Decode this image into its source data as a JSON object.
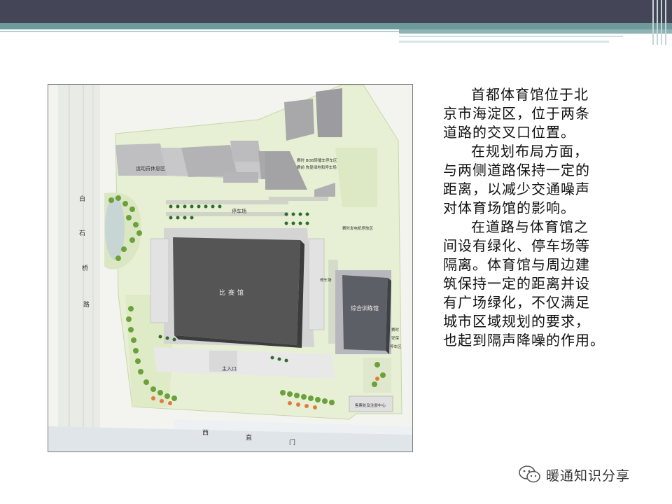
{
  "slide": {
    "map_labels": {
      "athlete_rest": "运动员休息区",
      "parking": "停车场",
      "main_hall": "比赛馆",
      "training_hall": "综合训练馆",
      "main_entrance": "主入口",
      "road_vertical": [
        "白",
        "石",
        "桥",
        "路"
      ],
      "road_horizontal": [
        "西",
        "直",
        "门"
      ],
      "bob_parking": "赛时 BOB转播车停车区",
      "tv_parking": "赛前 恢复绿地和停车场",
      "generator_area": "赛时发电机停放区",
      "parking2": "停车场",
      "security": [
        "赛时",
        "安保",
        "停车区"
      ],
      "ticket_center": "售票处及注册中心"
    },
    "paragraphs": [
      [
        "首都体育馆位于北",
        "京市海淀区，位于两条",
        "道路的交叉口位置。"
      ],
      [
        "在规划布局方面，",
        "与两侧道路保持一定的",
        "距离，以减少交通噪声",
        "对体育场馆的影响。"
      ],
      [
        "在道路与体育馆之",
        "间设有绿化、停车场等",
        "隔离。体育馆与周边建",
        "筑保持一定的距离并设",
        "有广场绿化，不仅满足",
        "城市区域规划的要求，",
        "也起到隔声降噪的作用。"
      ]
    ],
    "brand": "暖通知识分享"
  }
}
